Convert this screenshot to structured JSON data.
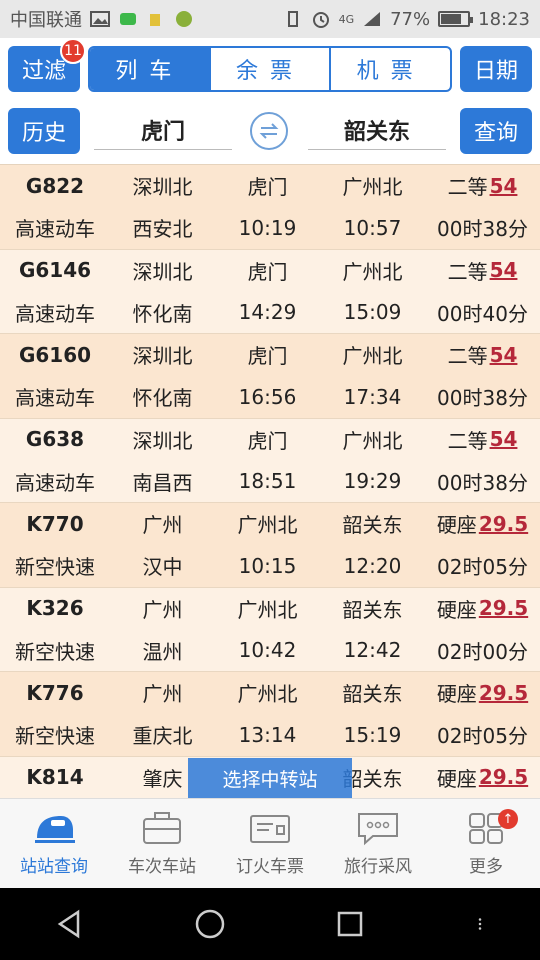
{
  "status": {
    "carrier": "中国联通",
    "network": "4G",
    "battery_text": "77%",
    "battery_level": 0.77,
    "time": "18:23"
  },
  "nav": {
    "filter_label": "过滤",
    "filter_badge": "11",
    "segments": [
      "列车",
      "余票",
      "机票"
    ],
    "active_segment": 0,
    "date_label": "日期"
  },
  "search": {
    "history_label": "历史",
    "from_station": "虎门",
    "to_station": "韶关东",
    "query_label": "查询"
  },
  "trains": [
    {
      "code": "G822",
      "type": "高速动车",
      "origin": "深圳北",
      "terminal": "西安北",
      "board": "虎门",
      "board_time": "10:19",
      "alight": "广州北",
      "alight_time": "10:57",
      "seat": "二等",
      "price": "54",
      "duration": "00时38分"
    },
    {
      "code": "G6146",
      "type": "高速动车",
      "origin": "深圳北",
      "terminal": "怀化南",
      "board": "虎门",
      "board_time": "14:29",
      "alight": "广州北",
      "alight_time": "15:09",
      "seat": "二等",
      "price": "54",
      "duration": "00时40分"
    },
    {
      "code": "G6160",
      "type": "高速动车",
      "origin": "深圳北",
      "terminal": "怀化南",
      "board": "虎门",
      "board_time": "16:56",
      "alight": "广州北",
      "alight_time": "17:34",
      "seat": "二等",
      "price": "54",
      "duration": "00时38分"
    },
    {
      "code": "G638",
      "type": "高速动车",
      "origin": "深圳北",
      "terminal": "南昌西",
      "board": "虎门",
      "board_time": "18:51",
      "alight": "广州北",
      "alight_time": "19:29",
      "seat": "二等",
      "price": "54",
      "duration": "00时38分"
    },
    {
      "code": "K770",
      "type": "新空快速",
      "origin": "广州",
      "terminal": "汉中",
      "board": "广州北",
      "board_time": "10:15",
      "alight": "韶关东",
      "alight_time": "12:20",
      "seat": "硬座",
      "price": "29.5",
      "duration": "02时05分"
    },
    {
      "code": "K326",
      "type": "新空快速",
      "origin": "广州",
      "terminal": "温州",
      "board": "广州北",
      "board_time": "10:42",
      "alight": "韶关东",
      "alight_time": "12:42",
      "seat": "硬座",
      "price": "29.5",
      "duration": "02时00分"
    },
    {
      "code": "K776",
      "type": "新空快速",
      "origin": "广州",
      "terminal": "重庆北",
      "board": "广州北",
      "board_time": "13:14",
      "alight": "韶关东",
      "alight_time": "15:19",
      "seat": "硬座",
      "price": "29.5",
      "duration": "02时05分"
    },
    {
      "code": "K814",
      "type": "",
      "origin": "肇庆",
      "terminal": "",
      "board": "",
      "board_time": "",
      "alight": "韶关东",
      "alight_time": "",
      "seat": "硬座",
      "price": "29.5",
      "duration": ""
    }
  ],
  "transfer_label": "选择中转站",
  "tabs": [
    {
      "label": "站站查询",
      "icon": "train-icon"
    },
    {
      "label": "车次车站",
      "icon": "briefcase-icon"
    },
    {
      "label": "订火车票",
      "icon": "ticket-icon"
    },
    {
      "label": "旅行采风",
      "icon": "chat-bubble-icon"
    },
    {
      "label": "更多",
      "icon": "grid-icon"
    }
  ],
  "colors": {
    "primary": "#2d79d8",
    "row_odd": "#fbe6d0",
    "row_even": "#fdf1e4",
    "price": "#b5283a",
    "badge": "#e23b2e"
  }
}
